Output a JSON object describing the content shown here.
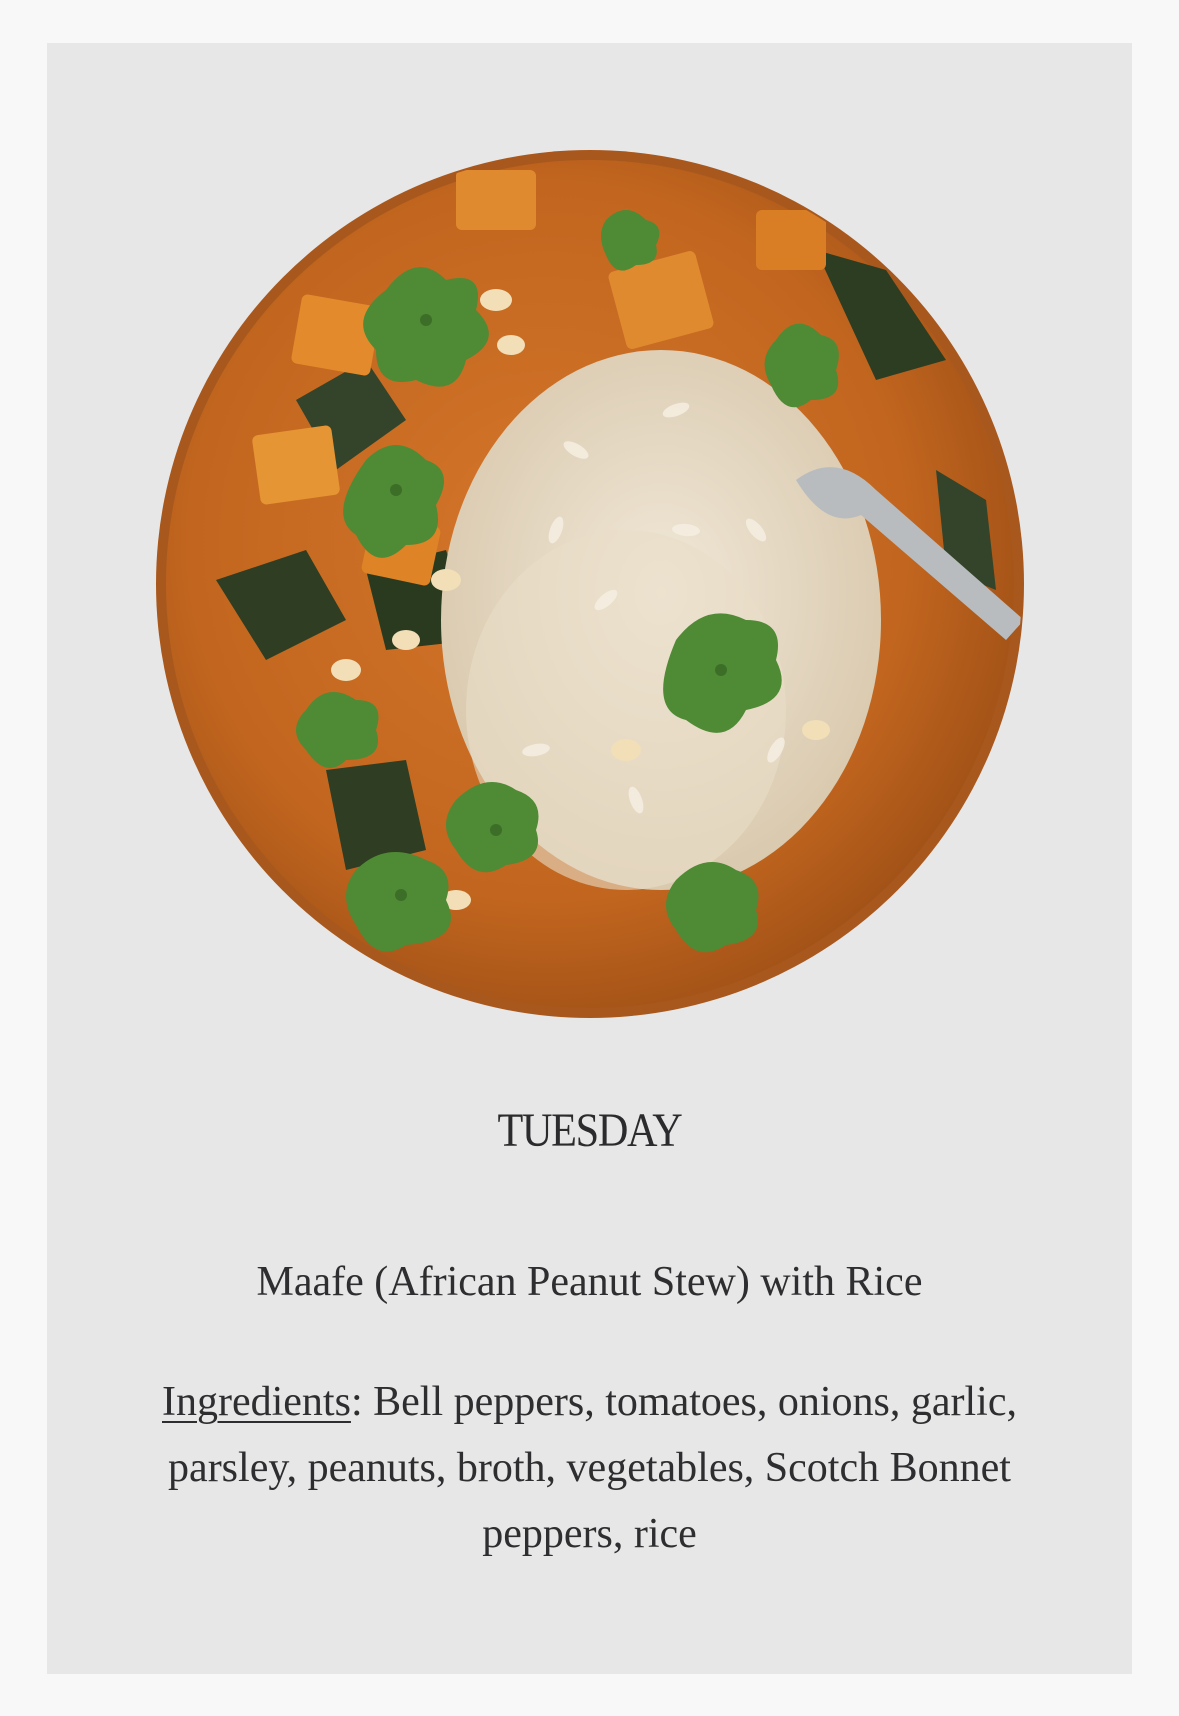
{
  "card": {
    "image_alt": "Bowl of peanut stew with rice, cilantro and a spoon",
    "day": "TUESDAY",
    "meal": "Maafe (African Peanut Stew) with Rice",
    "ingredients_label": "Ingredients",
    "ingredients_separator": ":",
    "ingredients_text": " Bell peppers, tomatoes, onions, garlic, parsley, peanuts, broth, vegetables, Scotch Bonnet peppers, rice"
  },
  "colors": {
    "page_background": "#f8f8f8",
    "card_background": "#e7e7e8",
    "stew": "#c2661f",
    "rice": "#e9ddc8",
    "cilantro": "#4f8a35",
    "text": "#2e2e30"
  }
}
